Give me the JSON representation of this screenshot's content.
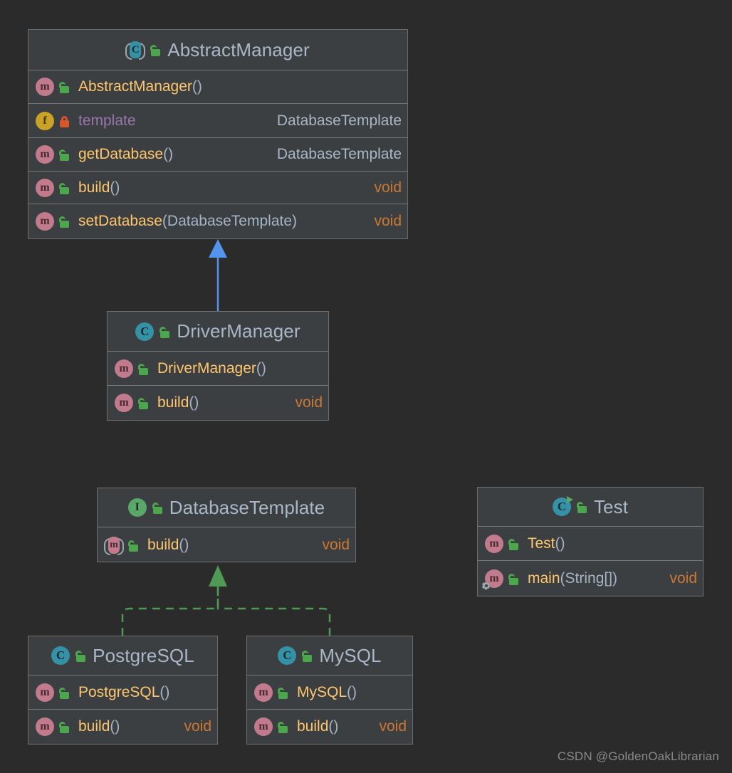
{
  "canvas": {
    "background": "#2b2b2b",
    "box_background": "#3c3f41",
    "box_border": "#6e6e6e",
    "divider": "#787878"
  },
  "palette": {
    "class_name": "#a9b7c6",
    "method_name": "#ffc66d",
    "field_name": "#9876aa",
    "type_ref": "#a9b7c6",
    "void": "#cc7832",
    "paren": "#a5b4c6",
    "inheritance_arrow": "#5394ec",
    "realization_arrow": "#4f9a54",
    "icon_class": "#3592a6",
    "icon_interface": "#59a869",
    "icon_method": "#c27b8c",
    "icon_field": "#c9a227",
    "lock_public": "#4ca64c",
    "lock_private": "#d9552a"
  },
  "classes": {
    "abstract_manager": {
      "name": "AbstractManager",
      "kind_icon": "abstract-class-icon",
      "visibility_icon": "public-unlocked-icon",
      "members": [
        {
          "icon": "method-icon",
          "visibility_icon": "public-unlocked-icon",
          "name": "AbstractManager",
          "params": "()",
          "type": ""
        },
        {
          "icon": "field-icon",
          "visibility_icon": "private-locked-icon",
          "name": "template",
          "params": "",
          "type": "DatabaseTemplate"
        },
        {
          "icon": "method-icon",
          "visibility_icon": "public-unlocked-icon",
          "name": "getDatabase",
          "params": "()",
          "type": "DatabaseTemplate"
        },
        {
          "icon": "method-icon",
          "visibility_icon": "public-unlocked-icon",
          "name": "build",
          "params": "()",
          "type": "void"
        },
        {
          "icon": "method-icon",
          "visibility_icon": "public-unlocked-icon",
          "name": "setDatabase",
          "params": "(DatabaseTemplate)",
          "type": "void"
        }
      ]
    },
    "driver_manager": {
      "name": "DriverManager",
      "kind_icon": "class-icon",
      "visibility_icon": "public-unlocked-icon",
      "members": [
        {
          "icon": "method-icon",
          "visibility_icon": "public-unlocked-icon",
          "name": "DriverManager",
          "params": "()",
          "type": ""
        },
        {
          "icon": "method-icon",
          "visibility_icon": "public-unlocked-icon",
          "name": "build",
          "params": "()",
          "type": "void"
        }
      ]
    },
    "database_template": {
      "name": "DatabaseTemplate",
      "kind_icon": "interface-icon",
      "visibility_icon": "public-unlocked-icon",
      "members": [
        {
          "icon": "abstract-method-icon",
          "visibility_icon": "public-unlocked-icon",
          "name": "build",
          "params": "()",
          "type": "void"
        }
      ]
    },
    "test": {
      "name": "Test",
      "kind_icon": "runnable-class-icon",
      "visibility_icon": "public-unlocked-icon",
      "members": [
        {
          "icon": "method-icon",
          "visibility_icon": "public-unlocked-icon",
          "name": "Test",
          "params": "()",
          "type": ""
        },
        {
          "icon": "static-method-icon",
          "visibility_icon": "public-unlocked-icon",
          "name": "main",
          "params": "(String[])",
          "type": "void"
        }
      ]
    },
    "postgresql": {
      "name": "PostgreSQL",
      "kind_icon": "class-icon",
      "visibility_icon": "public-unlocked-icon",
      "members": [
        {
          "icon": "method-icon",
          "visibility_icon": "public-unlocked-icon",
          "name": "PostgreSQL",
          "params": "()",
          "type": ""
        },
        {
          "icon": "method-icon",
          "visibility_icon": "public-unlocked-icon",
          "name": "build",
          "params": "()",
          "type": "void"
        }
      ]
    },
    "mysql": {
      "name": "MySQL",
      "kind_icon": "class-icon",
      "visibility_icon": "public-unlocked-icon",
      "members": [
        {
          "icon": "method-icon",
          "visibility_icon": "public-unlocked-icon",
          "name": "MySQL",
          "params": "()",
          "type": ""
        },
        {
          "icon": "method-icon",
          "visibility_icon": "public-unlocked-icon",
          "name": "build",
          "params": "()",
          "type": "void"
        }
      ]
    }
  },
  "relations": [
    {
      "id": "driver-extends-abstract",
      "type": "inheritance",
      "from": "DriverManager",
      "to": "AbstractManager",
      "line": "solid",
      "color": "#5394ec"
    },
    {
      "id": "postgresql-implements-databasetemplate",
      "type": "realization",
      "from": "PostgreSQL",
      "to": "DatabaseTemplate",
      "line": "dashed",
      "color": "#4f9a54"
    },
    {
      "id": "mysql-implements-databasetemplate",
      "type": "realization",
      "from": "MySQL",
      "to": "DatabaseTemplate",
      "line": "dashed",
      "color": "#4f9a54"
    }
  ],
  "watermark": {
    "text": "CSDN @GoldenOakLibrarian"
  }
}
